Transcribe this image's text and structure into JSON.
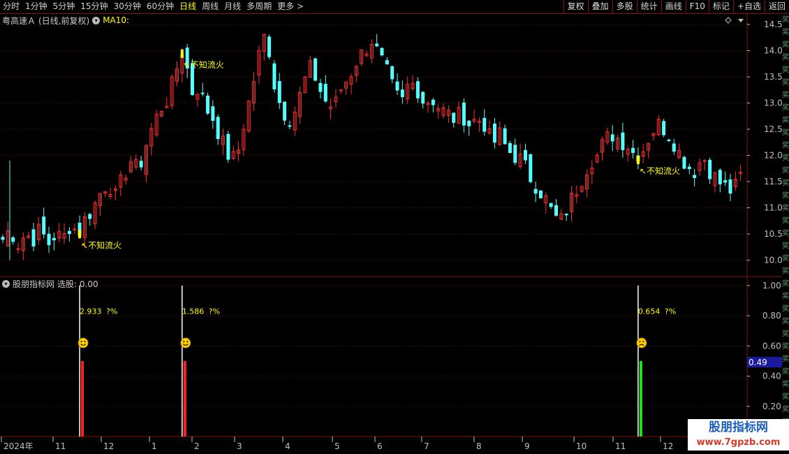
{
  "toolbar": {
    "periods": [
      "分时",
      "1分钟",
      "5分钟",
      "15分钟",
      "30分钟",
      "60分钟",
      "日线",
      "周线",
      "月线",
      "多周期",
      "更多"
    ],
    "active_period": "日线",
    "more_arrow": ">",
    "buttons": [
      "复权",
      "叠加",
      "多股",
      "统计",
      "画线",
      "F10",
      "标记",
      "+自选",
      "返回"
    ]
  },
  "main_panel": {
    "stock_name": "粤高速Ａ",
    "mode": "(日线,前复权)",
    "indicator": "MA10:",
    "annotation_text": "↖不知流火",
    "y_ticks": [
      "14.50",
      "14.00",
      "13.50",
      "13.00",
      "12.50",
      "12.00",
      "11.50",
      "11.00",
      "10.50",
      "10.00"
    ]
  },
  "sub_panel": {
    "title": "股朋指标网",
    "subtitle": "选股: 0.00",
    "y_ticks": [
      "1.00",
      "0.80",
      "0.60",
      "0.40",
      "0.20"
    ],
    "cursor_value": "0.49",
    "signal_labels": [
      {
        "value": "2.933",
        "suffix": "?%"
      },
      {
        "value": "1.586",
        "suffix": "?%"
      },
      {
        "value": "0.654",
        "suffix": "?%"
      }
    ]
  },
  "x_axis": {
    "labels": [
      "2024年",
      "11",
      "12",
      "1",
      "2",
      "3",
      "4",
      "5",
      "6",
      "7",
      "8",
      "9",
      "10",
      "11",
      "12"
    ]
  },
  "chart_data": {
    "type": "candlestick",
    "title": "粤高速Ａ (日线,前复权)",
    "ylim": [
      9.7,
      14.7
    ],
    "up_color": "#ff3030",
    "down_color": "#54ffff",
    "series": [
      {
        "name": "price_path",
        "values": [
          10.4,
          10.6,
          10.3,
          10.5,
          10.4,
          10.6,
          10.3,
          10.5,
          10.4,
          10.7,
          10.5,
          10.8,
          11.0,
          11.3,
          11.5,
          11.2,
          11.6,
          11.9,
          11.7,
          12.2,
          12.6,
          12.9,
          13.1,
          13.6,
          14.1,
          13.2,
          13.3,
          12.9,
          12.7,
          12.3,
          12.0,
          11.9,
          12.6,
          13.2,
          13.9,
          14.4,
          13.4,
          12.9,
          12.7,
          12.9,
          13.4,
          13.7,
          13.3,
          13.0,
          12.9,
          13.3,
          13.5,
          13.8,
          14.0,
          14.2,
          13.9,
          13.6,
          13.2,
          13.0,
          13.4,
          13.3,
          13.0,
          13.1,
          12.9,
          12.8,
          12.7,
          12.8,
          12.6,
          12.7,
          12.6,
          12.2,
          12.4,
          12.1,
          12.0,
          11.9,
          11.6,
          11.4,
          11.2,
          10.9,
          10.7,
          11.0,
          11.3,
          11.6,
          11.9,
          12.0,
          12.3,
          12.4,
          12.3,
          12.2,
          12.0,
          12.1,
          12.4,
          12.6,
          12.5,
          12.3,
          12.0,
          11.8,
          11.7,
          12.0,
          11.7,
          11.5,
          11.4,
          11.3,
          11.6
        ]
      },
      {
        "name": "选股",
        "values": []
      }
    ],
    "signals": [
      {
        "x_index": 15,
        "value": 1.0,
        "bar": 0.5,
        "color": "#ff2020",
        "mood": "smile"
      },
      {
        "x_index": 35,
        "value": 1.0,
        "bar": 0.5,
        "color": "#ff2020",
        "mood": "smile"
      },
      {
        "x_index": 124,
        "value": 1.0,
        "bar": 0.5,
        "color": "#20e020",
        "mood": "frown"
      }
    ],
    "sub_ylim": [
      0,
      1.05
    ],
    "colors": {
      "grid": "#8a1010",
      "axis_text": "#c0c0c0",
      "annotation": "#ffff00"
    }
  },
  "watermark": {
    "name": "股朋指标网",
    "url": "www.7gpzb.com"
  }
}
